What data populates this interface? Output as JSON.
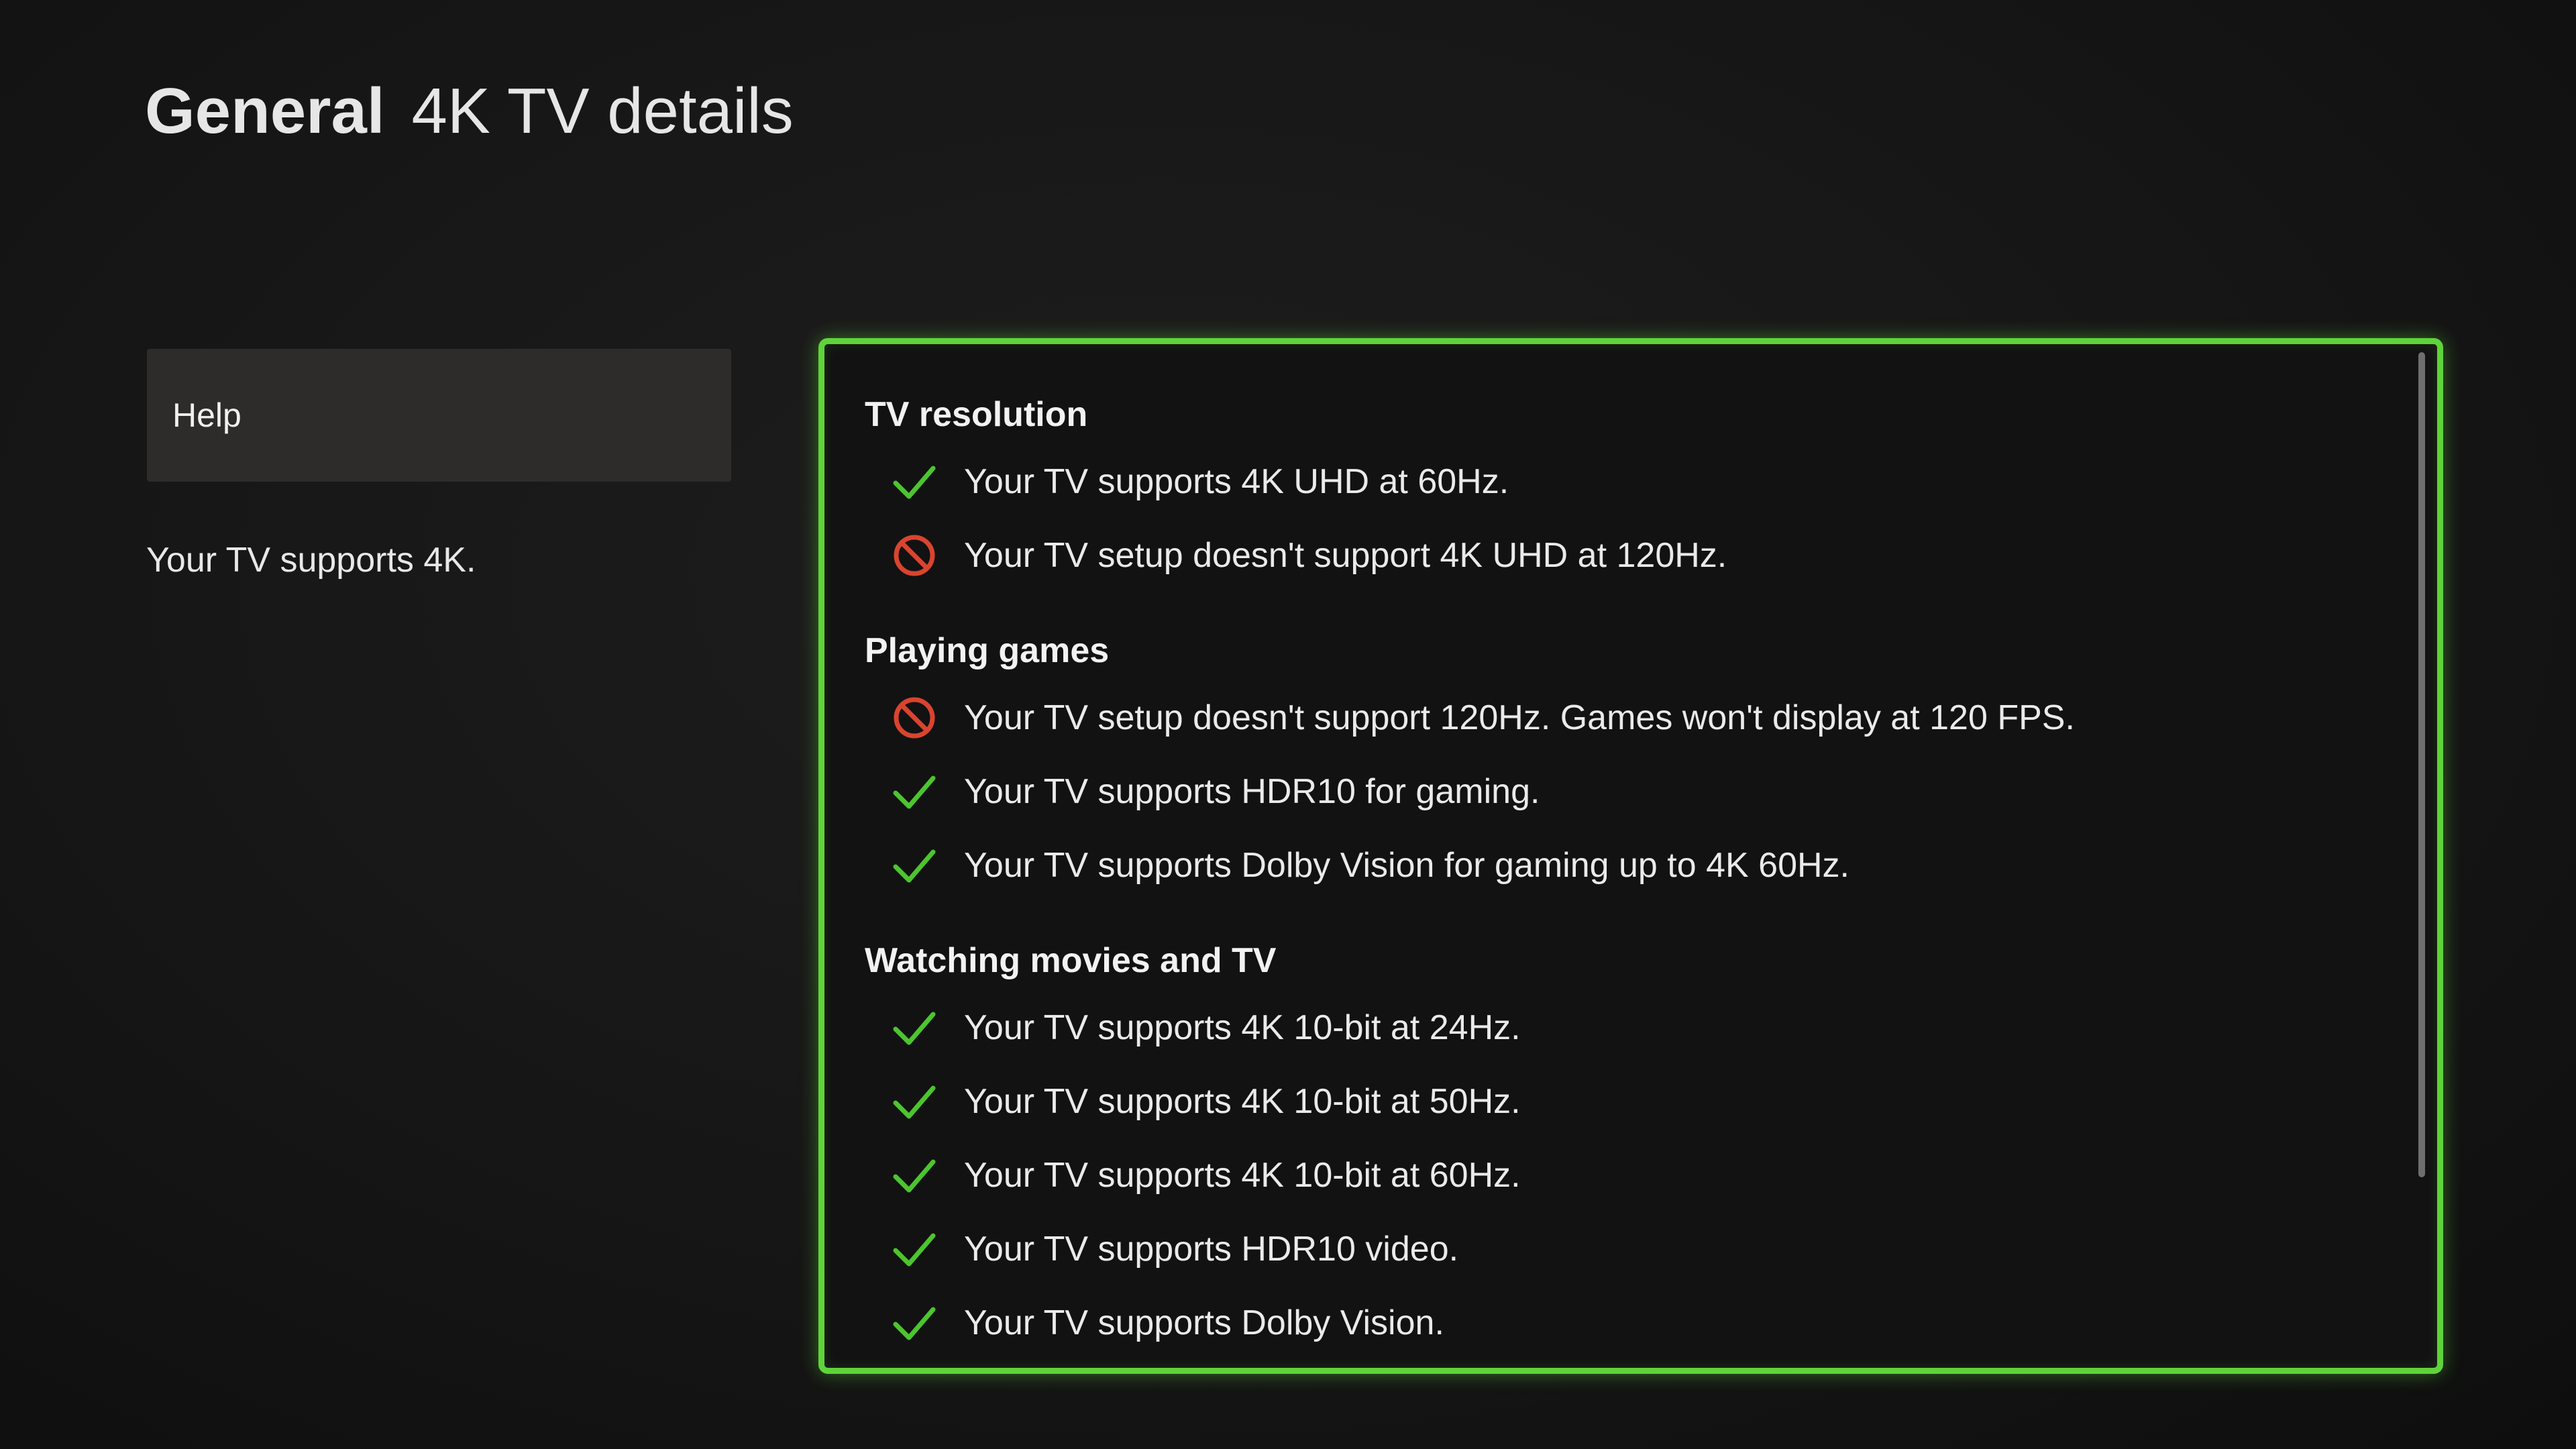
{
  "header": {
    "section": "General",
    "page_title": "4K TV details"
  },
  "sidebar": {
    "help_label": "Help",
    "summary": "Your TV supports 4K."
  },
  "details": {
    "sections": [
      {
        "heading": "TV resolution",
        "items": [
          {
            "status": "supported",
            "icon": "checkmark-icon",
            "text": "Your TV supports 4K UHD at 60Hz."
          },
          {
            "status": "unsupported",
            "icon": "blocked-icon",
            "text": "Your TV setup doesn't support 4K UHD at 120Hz."
          }
        ]
      },
      {
        "heading": "Playing games",
        "items": [
          {
            "status": "unsupported",
            "icon": "blocked-icon",
            "text": "Your TV setup doesn't support 120Hz. Games won't display at 120 FPS."
          },
          {
            "status": "supported",
            "icon": "checkmark-icon",
            "text": "Your TV supports HDR10 for gaming."
          },
          {
            "status": "supported",
            "icon": "checkmark-icon",
            "text": "Your TV supports Dolby Vision for gaming up to 4K 60Hz."
          }
        ]
      },
      {
        "heading": "Watching movies and TV",
        "items": [
          {
            "status": "supported",
            "icon": "checkmark-icon",
            "text": "Your TV supports 4K 10-bit at 24Hz."
          },
          {
            "status": "supported",
            "icon": "checkmark-icon",
            "text": "Your TV supports 4K 10-bit at 50Hz."
          },
          {
            "status": "supported",
            "icon": "checkmark-icon",
            "text": "Your TV supports 4K 10-bit at 60Hz."
          },
          {
            "status": "supported",
            "icon": "checkmark-icon",
            "text": "Your TV supports HDR10 video."
          },
          {
            "status": "supported",
            "icon": "checkmark-icon",
            "text": "Your TV supports Dolby Vision."
          }
        ]
      }
    ]
  },
  "colors": {
    "focus_border": "#5fd33a",
    "check": "#4cc52e",
    "blocked": "#d9442f",
    "background": "#161616",
    "help_button_bg": "#2e2c2b"
  }
}
